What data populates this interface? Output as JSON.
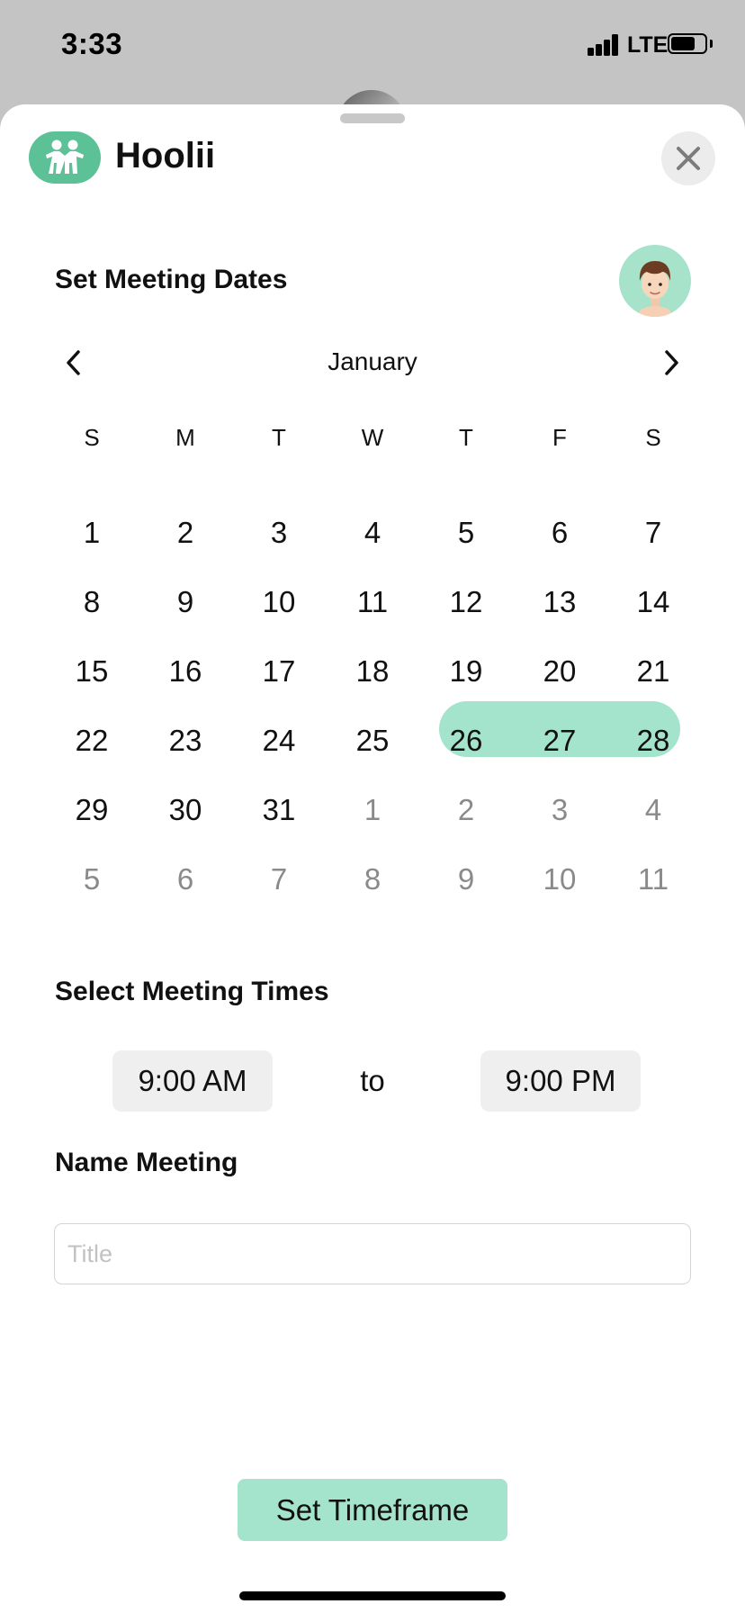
{
  "status_bar": {
    "time": "3:33",
    "network": "LTE",
    "battery_level": 0.75
  },
  "header": {
    "app_name": "Hoolii",
    "logo_icon": "friends-logo-icon",
    "close_icon": "close-icon"
  },
  "dates_section": {
    "title": "Set Meeting Dates",
    "avatar_icon": "user-avatar-icon"
  },
  "calendar": {
    "month": "January",
    "prev_icon": "chevron-left-icon",
    "next_icon": "chevron-right-icon",
    "weekdays": [
      "S",
      "M",
      "T",
      "W",
      "T",
      "F",
      "S"
    ],
    "days": [
      {
        "label": "1",
        "in_month": true
      },
      {
        "label": "2",
        "in_month": true
      },
      {
        "label": "3",
        "in_month": true
      },
      {
        "label": "4",
        "in_month": true
      },
      {
        "label": "5",
        "in_month": true
      },
      {
        "label": "6",
        "in_month": true
      },
      {
        "label": "7",
        "in_month": true
      },
      {
        "label": "8",
        "in_month": true
      },
      {
        "label": "9",
        "in_month": true
      },
      {
        "label": "10",
        "in_month": true
      },
      {
        "label": "11",
        "in_month": true
      },
      {
        "label": "12",
        "in_month": true
      },
      {
        "label": "13",
        "in_month": true
      },
      {
        "label": "14",
        "in_month": true
      },
      {
        "label": "15",
        "in_month": true
      },
      {
        "label": "16",
        "in_month": true
      },
      {
        "label": "17",
        "in_month": true
      },
      {
        "label": "18",
        "in_month": true
      },
      {
        "label": "19",
        "in_month": true
      },
      {
        "label": "20",
        "in_month": true
      },
      {
        "label": "21",
        "in_month": true
      },
      {
        "label": "22",
        "in_month": true
      },
      {
        "label": "23",
        "in_month": true
      },
      {
        "label": "24",
        "in_month": true
      },
      {
        "label": "25",
        "in_month": true
      },
      {
        "label": "26",
        "in_month": true,
        "selected": true
      },
      {
        "label": "27",
        "in_month": true,
        "selected": true
      },
      {
        "label": "28",
        "in_month": true,
        "selected": true
      },
      {
        "label": "29",
        "in_month": true
      },
      {
        "label": "30",
        "in_month": true
      },
      {
        "label": "31",
        "in_month": true
      },
      {
        "label": "1",
        "in_month": false
      },
      {
        "label": "2",
        "in_month": false
      },
      {
        "label": "3",
        "in_month": false
      },
      {
        "label": "4",
        "in_month": false
      },
      {
        "label": "5",
        "in_month": false
      },
      {
        "label": "6",
        "in_month": false
      },
      {
        "label": "7",
        "in_month": false
      },
      {
        "label": "8",
        "in_month": false
      },
      {
        "label": "9",
        "in_month": false
      },
      {
        "label": "10",
        "in_month": false
      },
      {
        "label": "11",
        "in_month": false
      }
    ]
  },
  "times_section": {
    "title": "Select Meeting Times",
    "start": "9:00 AM",
    "separator": "to",
    "end": "9:00 PM"
  },
  "name_section": {
    "title": "Name Meeting",
    "placeholder": "Title",
    "value": ""
  },
  "submit": {
    "label": "Set Timeframe"
  },
  "colors": {
    "accent": "#5cc197",
    "selection": "#a4e3cc",
    "chip_background": "#efefef"
  }
}
